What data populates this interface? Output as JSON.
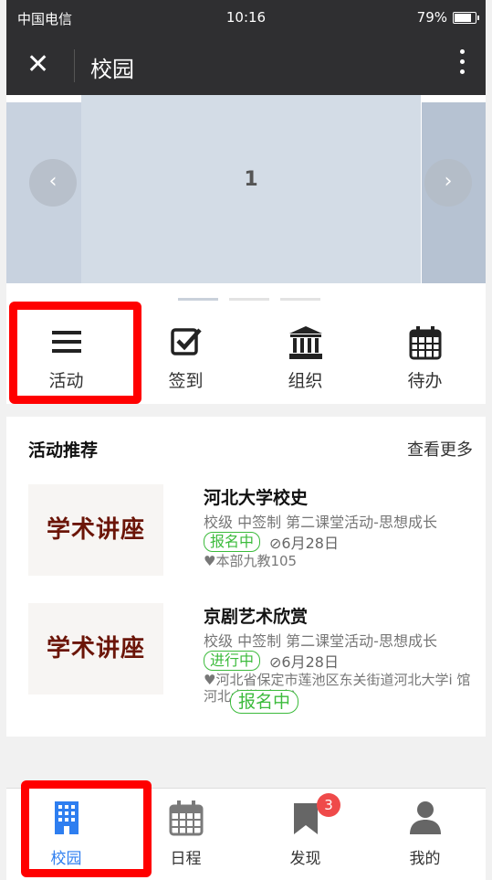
{
  "status": {
    "carrier": "中国电信",
    "time": "10:16",
    "battery": "79%"
  },
  "nav": {
    "title": "校园"
  },
  "carousel": {
    "current": "1",
    "prev": "‹",
    "next": "›"
  },
  "quick_menu": [
    {
      "label": "活动",
      "icon": "list-icon"
    },
    {
      "label": "签到",
      "icon": "checkbox-icon"
    },
    {
      "label": "组织",
      "icon": "institution-icon"
    },
    {
      "label": "待办",
      "icon": "calendar-icon"
    }
  ],
  "recommend": {
    "title": "活动推荐",
    "more": "查看更多",
    "items": [
      {
        "thumb": "学术讲座",
        "title": "河北大学校史",
        "meta": "校级 中签制 第二课堂活动-思想成长",
        "status": "报名中",
        "date": "⊘6月28日",
        "location": "♥本部九教105"
      },
      {
        "thumb": "学术讲座",
        "title": "京剧艺术欣赏",
        "meta": "校级 中签制 第二课堂活动-思想成长",
        "status": "进行中",
        "date": "⊘6月28日",
        "location": "♥河北省保定市莲池区东关街道河北大学i      馆河北大学(南院)"
      }
    ],
    "floating_tag": "报名中"
  },
  "tabs": [
    {
      "label": "校园",
      "icon": "building-icon",
      "active": true
    },
    {
      "label": "日程",
      "icon": "calendar-icon"
    },
    {
      "label": "发现",
      "icon": "bookmark-icon",
      "badge": "3"
    },
    {
      "label": "我的",
      "icon": "user-icon"
    }
  ],
  "colors": {
    "accent": "#2e7ef0",
    "green": "#3cbb3c",
    "highlight": "#ff0000",
    "bar": "#2f2f31"
  }
}
